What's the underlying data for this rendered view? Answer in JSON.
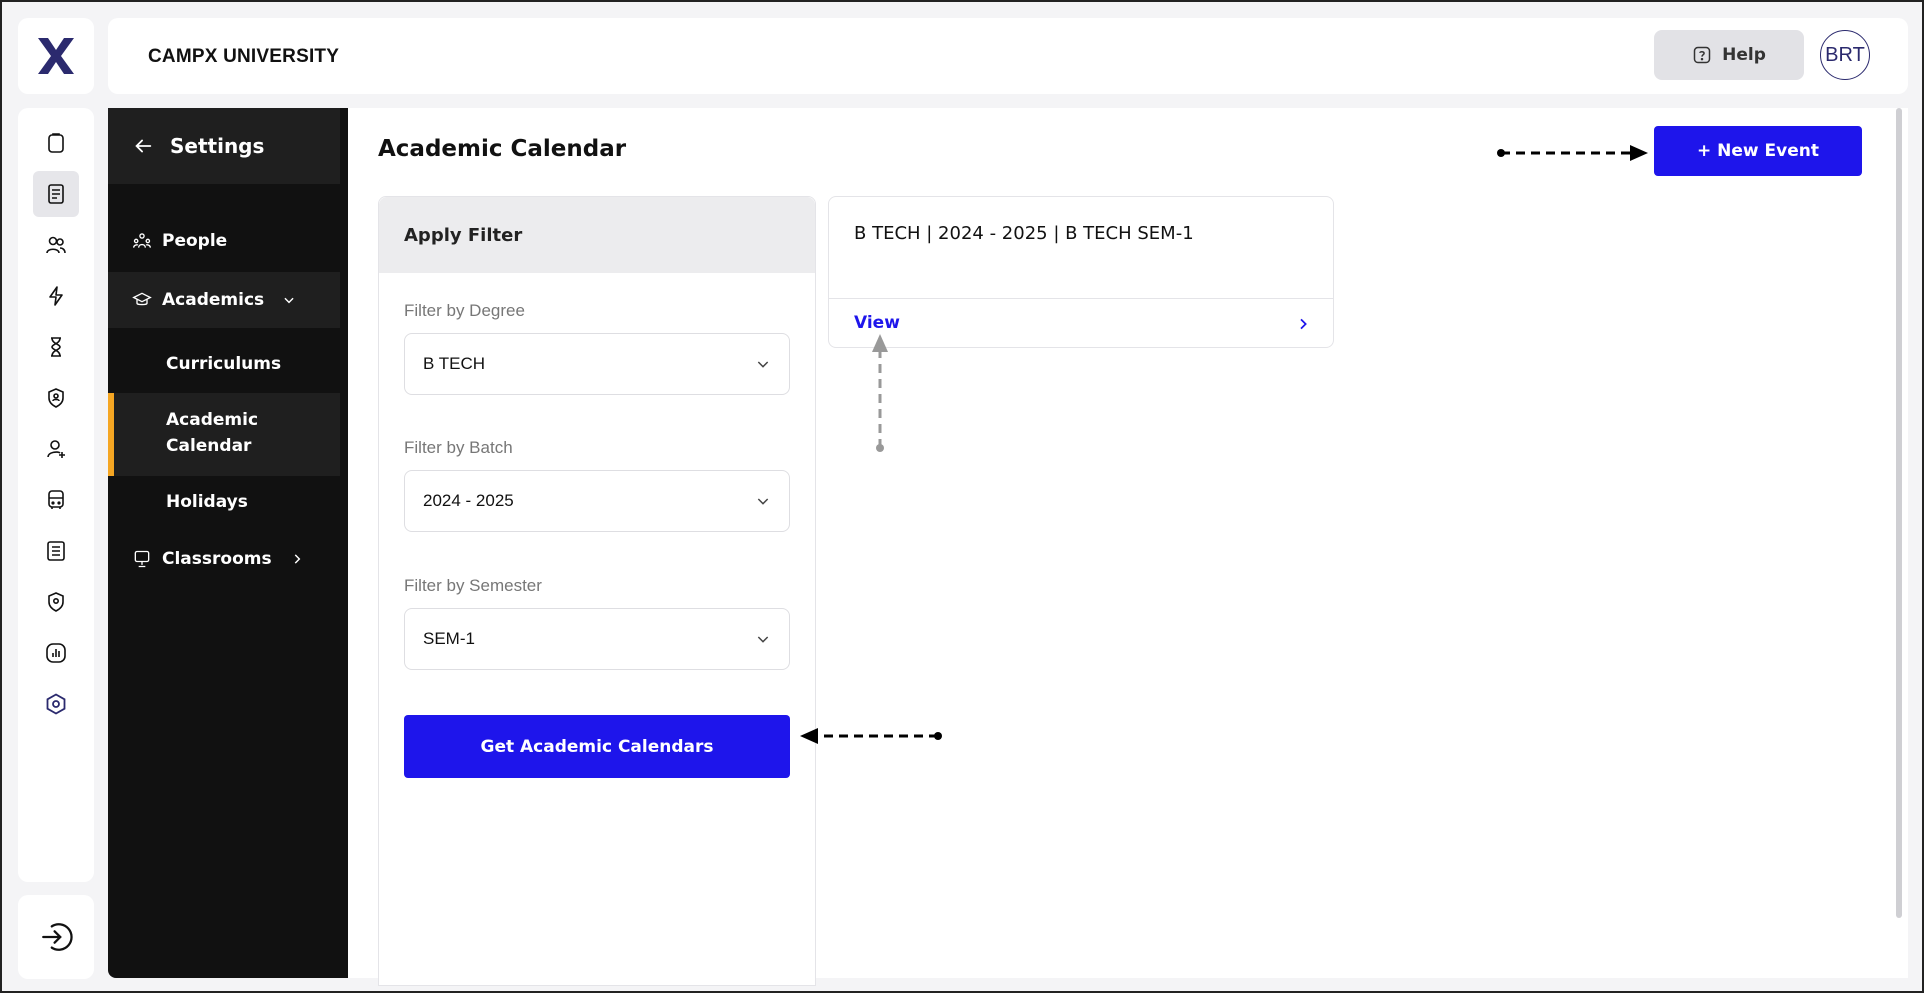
{
  "header": {
    "university": "CAMPX UNIVERSITY",
    "help_label": "Help",
    "avatar_initials": "BRT"
  },
  "settings": {
    "title": "Settings",
    "items": [
      {
        "label": "People"
      },
      {
        "label": "Academics"
      },
      {
        "label": "Curriculums"
      },
      {
        "label": "Academic Calendar"
      },
      {
        "label": "Holidays"
      },
      {
        "label": "Classrooms"
      }
    ]
  },
  "main": {
    "title": "Academic Calendar",
    "new_event_label": "+ New Event",
    "filter": {
      "heading": "Apply Filter",
      "degree_label": "Filter by Degree",
      "degree_value": "B TECH",
      "batch_label": "Filter by Batch",
      "batch_value": "2024 - 2025",
      "semester_label": "Filter by Semester",
      "semester_value": "SEM-1",
      "submit_label": "Get Academic Calendars"
    },
    "card": {
      "title": "B TECH | 2024 - 2025 | B TECH SEM-1",
      "view_label": "View"
    }
  },
  "colors": {
    "primary": "#1e15eb",
    "sidebar_bg": "#111111",
    "active_indicator": "#f5a623"
  }
}
